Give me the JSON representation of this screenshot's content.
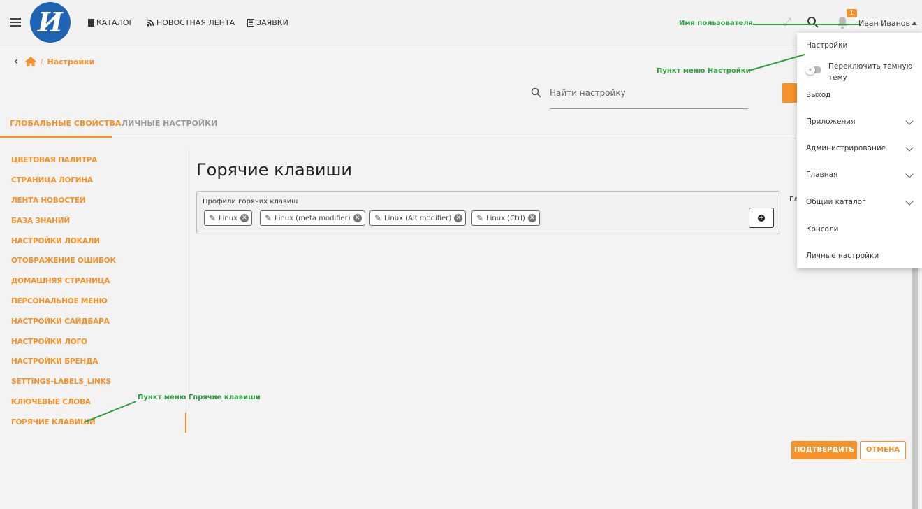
{
  "header": {
    "logo_text": "И",
    "nav": [
      {
        "label": "КАТАЛОГ",
        "icon": "book-icon"
      },
      {
        "label": "НОВОСТНАЯ ЛЕНТА",
        "icon": "rss-icon"
      },
      {
        "label": "ЗАЯВКИ",
        "icon": "requests-icon"
      }
    ],
    "notification_count": "1",
    "username": "Иван Иванов"
  },
  "breadcrumb": {
    "current": "Настройки"
  },
  "search": {
    "placeholder": "Найти настройку"
  },
  "tabs": [
    {
      "label": "ГЛОБАЛЬНЫЕ СВОЙСТВА",
      "active": true
    },
    {
      "label": "ЛИЧНЫЕ НАСТРОЙКИ",
      "active": false
    }
  ],
  "sidebar": {
    "items": [
      "ЦВЕТОВАЯ ПАЛИТРА",
      "СТРАНИЦА ЛОГИНА",
      "ЛЕНТА НОВОСТЕЙ",
      "БАЗА ЗНАНИЙ",
      "НАСТРОЙКИ ЛОКАЛИ",
      "ОТОБРАЖЕНИЕ ОШИБОК",
      "ДОМАШНЯЯ СТРАНИЦА",
      "ПЕРСОНАЛЬНОЕ МЕНЮ",
      "НАСТРОЙКИ САЙДБАРА",
      "НАСТРОЙКИ ЛОГО",
      "НАСТРОЙКИ БРЕНДА",
      "SETTINGS-LABELS_LINKS",
      "КЛЮЧЕВЫЕ СЛОВА",
      "ГОРЯЧИЕ КЛАВИШИ"
    ],
    "active_index": 13
  },
  "main": {
    "title": "Горячие клавиши",
    "profiles_label": "Профили горячих клавиш",
    "profiles": [
      "Linux",
      "Linux (meta modifier)",
      "Linux (Alt modifier)",
      "Linux (Ctrl)"
    ],
    "partial_label": "Гл"
  },
  "actions": {
    "confirm": "ПОДТВЕРДИТЬ",
    "cancel": "ОТМЕНА"
  },
  "user_menu": {
    "settings": "Настройки",
    "theme_toggle": "Переключить темную тему",
    "logout": "Выход",
    "applications": "Приложения",
    "administration": "Администрирование",
    "main": "Главная",
    "catalog": "Общий каталог",
    "consoles": "Консоли",
    "personal_settings": "Личные настройки"
  },
  "annotations": {
    "username": "Имя пользователя",
    "settings_item": "Пункт меню Настройки",
    "hotkeys_item": "Пункт меню Гпрячие клавиши"
  },
  "colors": {
    "accent": "#f6922a",
    "annotation": "#2da042",
    "logo": "#1e63b4"
  }
}
